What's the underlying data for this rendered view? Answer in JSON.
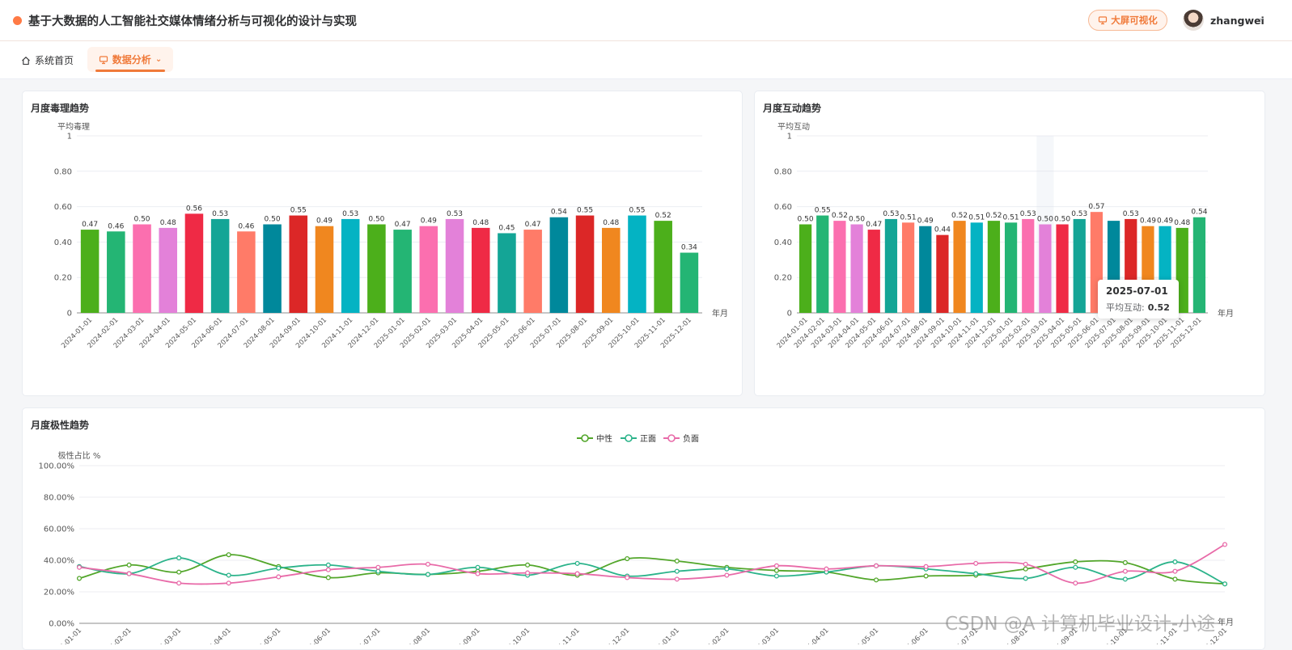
{
  "header": {
    "title": "基于大数据的人工智能社交媒体情绪分析与可视化的设计与实现",
    "big_screen_label": "大屏可视化",
    "username": "zhangwei"
  },
  "nav": {
    "home_label": "系统首页",
    "analysis_label": "数据分析"
  },
  "colors": {
    "accent": "#f07a3a",
    "neutral_line": "#52a62a",
    "positive_line": "#2bb38a",
    "negative_line": "#e86aa8"
  },
  "tooltip": {
    "date": "2025-07-01",
    "label": "平均互动:",
    "value": "0.52"
  },
  "watermark": "CSDN @A 计算机毕业设计-小途",
  "chart_data": [
    {
      "type": "bar",
      "title": "月度毒理趋势",
      "ylabel": "平均毒理",
      "xlabel": "年月",
      "ylim": [
        0,
        1
      ],
      "y_ticks": [
        "0",
        "0.20",
        "0.40",
        "0.60",
        "0.80",
        "1"
      ],
      "grid": true,
      "categories": [
        "2024-01-01",
        "2024-02-01",
        "2024-03-01",
        "2024-04-01",
        "2024-05-01",
        "2024-06-01",
        "2024-07-01",
        "2024-08-01",
        "2024-09-01",
        "2024-10-01",
        "2024-11-01",
        "2024-12-01",
        "2025-01-01",
        "2025-02-01",
        "2025-03-01",
        "2025-04-01",
        "2025-05-01",
        "2025-06-01",
        "2025-07-01",
        "2025-08-01",
        "2025-09-01",
        "2025-10-01",
        "2025-11-01",
        "2025-12-01"
      ],
      "values": [
        0.47,
        0.46,
        0.5,
        0.48,
        0.56,
        0.53,
        0.46,
        0.5,
        0.55,
        0.49,
        0.53,
        0.5,
        0.47,
        0.49,
        0.53,
        0.48,
        0.45,
        0.47,
        0.54,
        0.55,
        0.48,
        0.55,
        0.52,
        0.34
      ],
      "labels": [
        "0.47",
        "0.46",
        "0.50",
        "0.48",
        "0.56",
        "0.53",
        "0.46",
        "0.50",
        "0.55",
        "0.49",
        "0.53",
        "0.50",
        "0.47",
        "0.49",
        "0.53",
        "0.48",
        "0.45",
        "0.47",
        "0.54",
        "0.55",
        "0.48",
        "0.55",
        "0.52",
        "0.34"
      ],
      "bar_colors": [
        "#4caf1b",
        "#24b574",
        "#fb6faf",
        "#e381d9",
        "#ef2a45",
        "#14a596",
        "#ff7b68",
        "#00889b",
        "#dc2727",
        "#f0871f",
        "#04b3c3",
        "#4caf1b",
        "#24b574",
        "#fb6faf",
        "#e381d9",
        "#ef2a45",
        "#14a596",
        "#ff7b68",
        "#00889b",
        "#dc2727",
        "#f0871f",
        "#04b3c3",
        "#4caf1b",
        "#24b574"
      ]
    },
    {
      "type": "bar",
      "title": "月度互动趋势",
      "ylabel": "平均互动",
      "xlabel": "年月",
      "ylim": [
        0,
        1
      ],
      "y_ticks": [
        "0",
        "0.20",
        "0.40",
        "0.60",
        "0.80",
        "1"
      ],
      "grid": true,
      "categories": [
        "2024-01-01",
        "2024-02-01",
        "2024-03-01",
        "2024-04-01",
        "2024-05-01",
        "2024-06-01",
        "2024-07-01",
        "2024-08-01",
        "2024-09-01",
        "2024-10-01",
        "2024-11-01",
        "2024-12-01",
        "2025-01-01",
        "2025-02-01",
        "2025-03-01",
        "2025-04-01",
        "2025-05-01",
        "2025-06-01",
        "2025-07-01",
        "2025-08-01",
        "2025-09-01",
        "2025-10-01",
        "2025-11-01",
        "2025-12-01"
      ],
      "values": [
        0.5,
        0.55,
        0.52,
        0.5,
        0.47,
        0.53,
        0.51,
        0.49,
        0.44,
        0.52,
        0.51,
        0.52,
        0.51,
        0.53,
        0.5,
        0.5,
        0.53,
        0.57,
        0.52,
        0.53,
        0.49,
        0.49,
        0.48,
        0.54
      ],
      "labels": [
        "0.50",
        "0.55",
        "0.52",
        "0.50",
        "0.47",
        "0.53",
        "0.51",
        "0.49",
        "0.44",
        "0.52",
        "0.51",
        "0.52",
        "0.51",
        "0.53",
        "0.50",
        "0.50",
        "0.53",
        "0.57",
        "0.52",
        "0.53",
        "0.49",
        "0.49",
        "0.48",
        "0.54"
      ],
      "hidden_labels": [
        18
      ],
      "hover_index": 14,
      "bar_colors": [
        "#4caf1b",
        "#24b574",
        "#fb6faf",
        "#e381d9",
        "#ef2a45",
        "#14a596",
        "#ff7b68",
        "#00889b",
        "#dc2727",
        "#f0871f",
        "#04b3c3",
        "#4caf1b",
        "#24b574",
        "#fb6faf",
        "#e381d9",
        "#ef2a45",
        "#14a596",
        "#ff7b68",
        "#00889b",
        "#dc2727",
        "#f0871f",
        "#04b3c3",
        "#4caf1b",
        "#24b574"
      ]
    },
    {
      "type": "line",
      "title": "月度极性趋势",
      "ylabel": "极性占比 %",
      "xlabel": "年月",
      "ylim": [
        0,
        100
      ],
      "y_ticks": [
        "0.00%",
        "20.00%",
        "40.00%",
        "60.00%",
        "80.00%",
        "100.00%"
      ],
      "grid": true,
      "legend": "top-center",
      "x_tick_labels": [
        "4-01-01",
        "4-02-01",
        "4-03-01",
        "4-04-01",
        "4-05-01",
        "4-06-01",
        "4-07-01",
        "4-08-01",
        "4-09-01",
        "4-10-01",
        "4-11-01",
        "4-12-01",
        "5-01-01",
        "5-02-01",
        "5-03-01",
        "5-04-01",
        "5-05-01",
        "5-06-01",
        "5-07-01",
        "5-08-01",
        "5-09-01",
        "5-10-01",
        "5-11-01",
        "5-12-01"
      ],
      "series": [
        {
          "name": "中性",
          "color": "#52a62a",
          "values": [
            28.5,
            37,
            32.5,
            43.5,
            36,
            29,
            32,
            31,
            33,
            37,
            30.5,
            41,
            39.5,
            35.5,
            33.5,
            32.5,
            27.5,
            30,
            30.5,
            34.5,
            39,
            38.5,
            28,
            25
          ]
        },
        {
          "name": "正面",
          "color": "#2bb38a",
          "values": [
            36,
            31.5,
            41.5,
            30.5,
            35,
            37,
            33,
            31,
            35.5,
            30.5,
            38,
            30,
            33,
            34.5,
            30,
            32.5,
            36.5,
            34.5,
            31.5,
            28.5,
            35.5,
            28,
            39,
            25
          ]
        },
        {
          "name": "负面",
          "color": "#e86aa8",
          "values": [
            35.5,
            31.5,
            25.5,
            25.5,
            29.5,
            34,
            35.5,
            37.5,
            31.5,
            32,
            31.5,
            29,
            28,
            30.5,
            36.5,
            34.5,
            36.5,
            36,
            38,
            37.5,
            25.5,
            33,
            33,
            50
          ]
        }
      ]
    }
  ]
}
